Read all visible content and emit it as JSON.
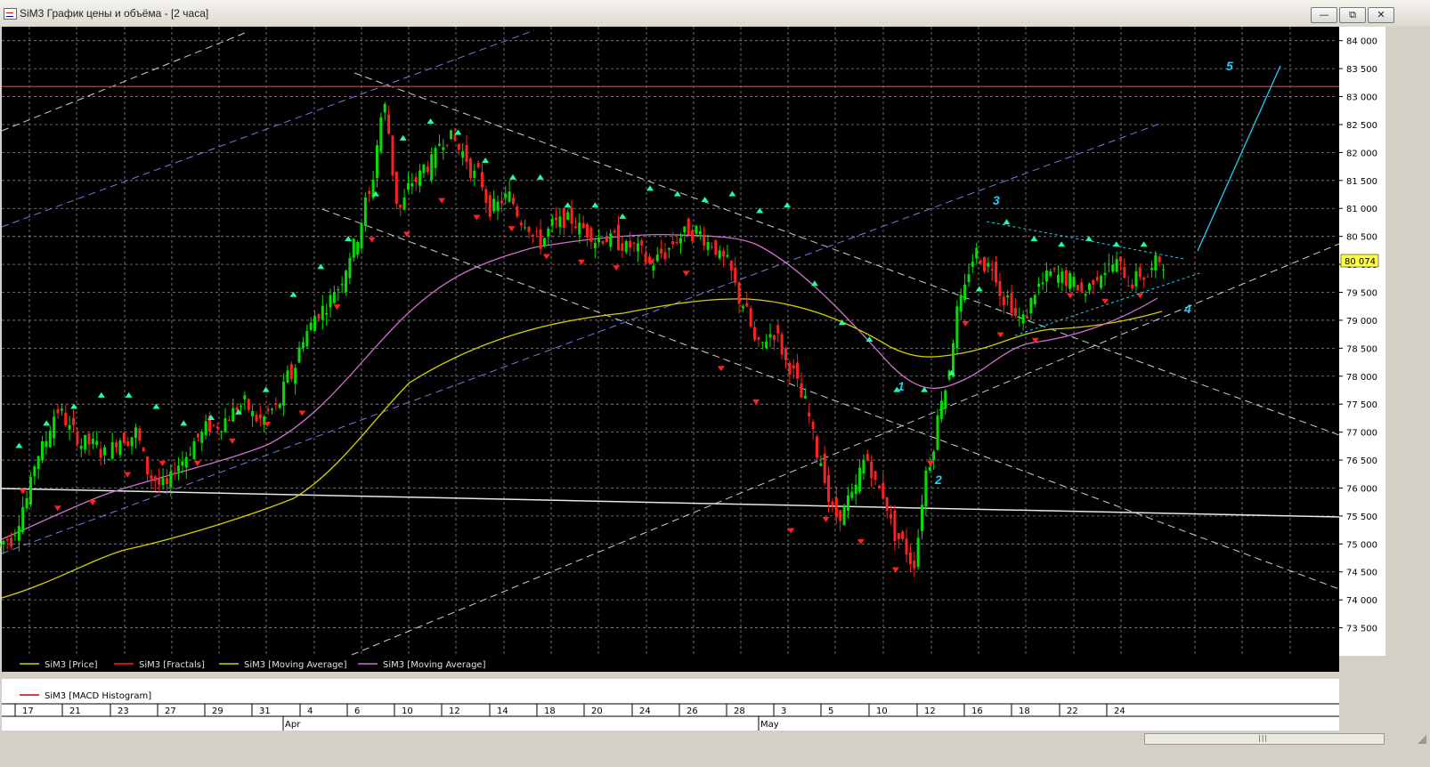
{
  "window": {
    "title": "SiM3 График цены и объёма - [2 часа]",
    "buttons": {
      "minimize": "—",
      "restore": "⧉",
      "close": "✕"
    }
  },
  "colors": {
    "background": "#000000",
    "grid": "#8a8a8a",
    "candle_up": "#00e000",
    "candle_down": "#ff2020",
    "fractal_up": "#20ffa0",
    "fractal_down": "#ff2020",
    "ma_slow": "#d4d000",
    "ma_fast": "#d070d0",
    "resistance": "#e03030",
    "annotation": "#20d0f0",
    "last_price_badge": "#ffff40"
  },
  "chart_data": {
    "type": "line",
    "title": "",
    "ylabel": "",
    "ylim": [
      73000,
      84250
    ],
    "y_ticks": [
      "84 000",
      "83 500",
      "83 000",
      "82 500",
      "82 000",
      "81 500",
      "81 000",
      "80 500",
      "80 000",
      "79 500",
      "79 000",
      "78 500",
      "78 000",
      "77 500",
      "77 000",
      "76 500",
      "76 000",
      "75 500",
      "75 000",
      "74 500",
      "74 000",
      "73 500"
    ],
    "x_ticks": [
      "17",
      "21",
      "23",
      "27",
      "29",
      "31",
      "4",
      "6",
      "10",
      "12",
      "14",
      "18",
      "20",
      "24",
      "26",
      "28",
      "3",
      "5",
      "10",
      "12",
      "16",
      "18",
      "22",
      "24"
    ],
    "month_labels": [
      "Apr",
      "May"
    ],
    "last_price": "80 074",
    "resistance_level": 83180,
    "close_series_approx": [
      75100,
      75800,
      76700,
      77400,
      77000,
      76800,
      76600,
      76900,
      77000,
      76200,
      76000,
      76500,
      76900,
      77100,
      77300,
      77500,
      77200,
      77400,
      78000,
      78800,
      79200,
      79600,
      80300,
      81200,
      82800,
      81000,
      81500,
      81800,
      82300,
      82000,
      81600,
      81000,
      81200,
      80800,
      80400,
      80700,
      80800,
      80600,
      80500,
      80400,
      80300,
      80000,
      80200,
      80500,
      80600,
      80400,
      80000,
      79300,
      78500,
      78800,
      78200,
      77500,
      76500,
      75500,
      75800,
      76500,
      75900,
      75100,
      74700,
      76500,
      77800,
      79300,
      80200,
      80000,
      79400,
      79000,
      79600,
      79800,
      79700,
      79500,
      79900,
      80000,
      79700,
      79800,
      80074
    ],
    "series": [
      {
        "name": "SiM3 [Price]",
        "color": "#c8c800"
      },
      {
        "name": "SiM3 [Fractals]",
        "color": "#ff2020"
      },
      {
        "name": "SiM3 [Moving Average]",
        "color": "#d4d000",
        "values": [
          74100,
          74600,
          75000,
          75500,
          76300,
          77400,
          78300,
          78900,
          79200,
          79400,
          79300,
          79000,
          78600,
          78400,
          78700,
          79000,
          79100
        ]
      },
      {
        "name": "SiM3 [Moving Average]",
        "color": "#d070d0",
        "values": [
          75000,
          75900,
          76300,
          76800,
          77800,
          79500,
          80200,
          80500,
          80600,
          80400,
          79800,
          78400,
          77800,
          78200,
          78900,
          79300
        ]
      }
    ],
    "fractal_up_levels": [
      76700,
      77100,
      77400,
      77600,
      77600,
      77400,
      77100,
      77200,
      77300,
      77700,
      79400,
      79900,
      80400,
      81200,
      82200,
      82500,
      82300,
      81800,
      81500,
      81500,
      81000,
      81000,
      80800,
      81300,
      81200,
      81100,
      81200,
      80900,
      81000,
      79600,
      78900,
      78600,
      77700,
      77700,
      78000,
      79500,
      80700,
      80400,
      80300,
      80400,
      80300,
      80300
    ],
    "fractal_down_levels": [
      76000,
      75700,
      75800,
      76300,
      76500,
      76500,
      76900,
      77200,
      77400,
      79300,
      80500,
      80600,
      81200,
      80900,
      80700,
      80200,
      80100,
      80000,
      80100,
      79900,
      78200,
      77600,
      75300,
      75500,
      75100,
      74600,
      76500,
      79000,
      78800,
      78700,
      79500,
      79400,
      79500
    ],
    "annotations": [
      "1",
      "2",
      "3",
      "4",
      "5"
    ],
    "macd_legend": "SiM3 [MACD Histogram]"
  }
}
